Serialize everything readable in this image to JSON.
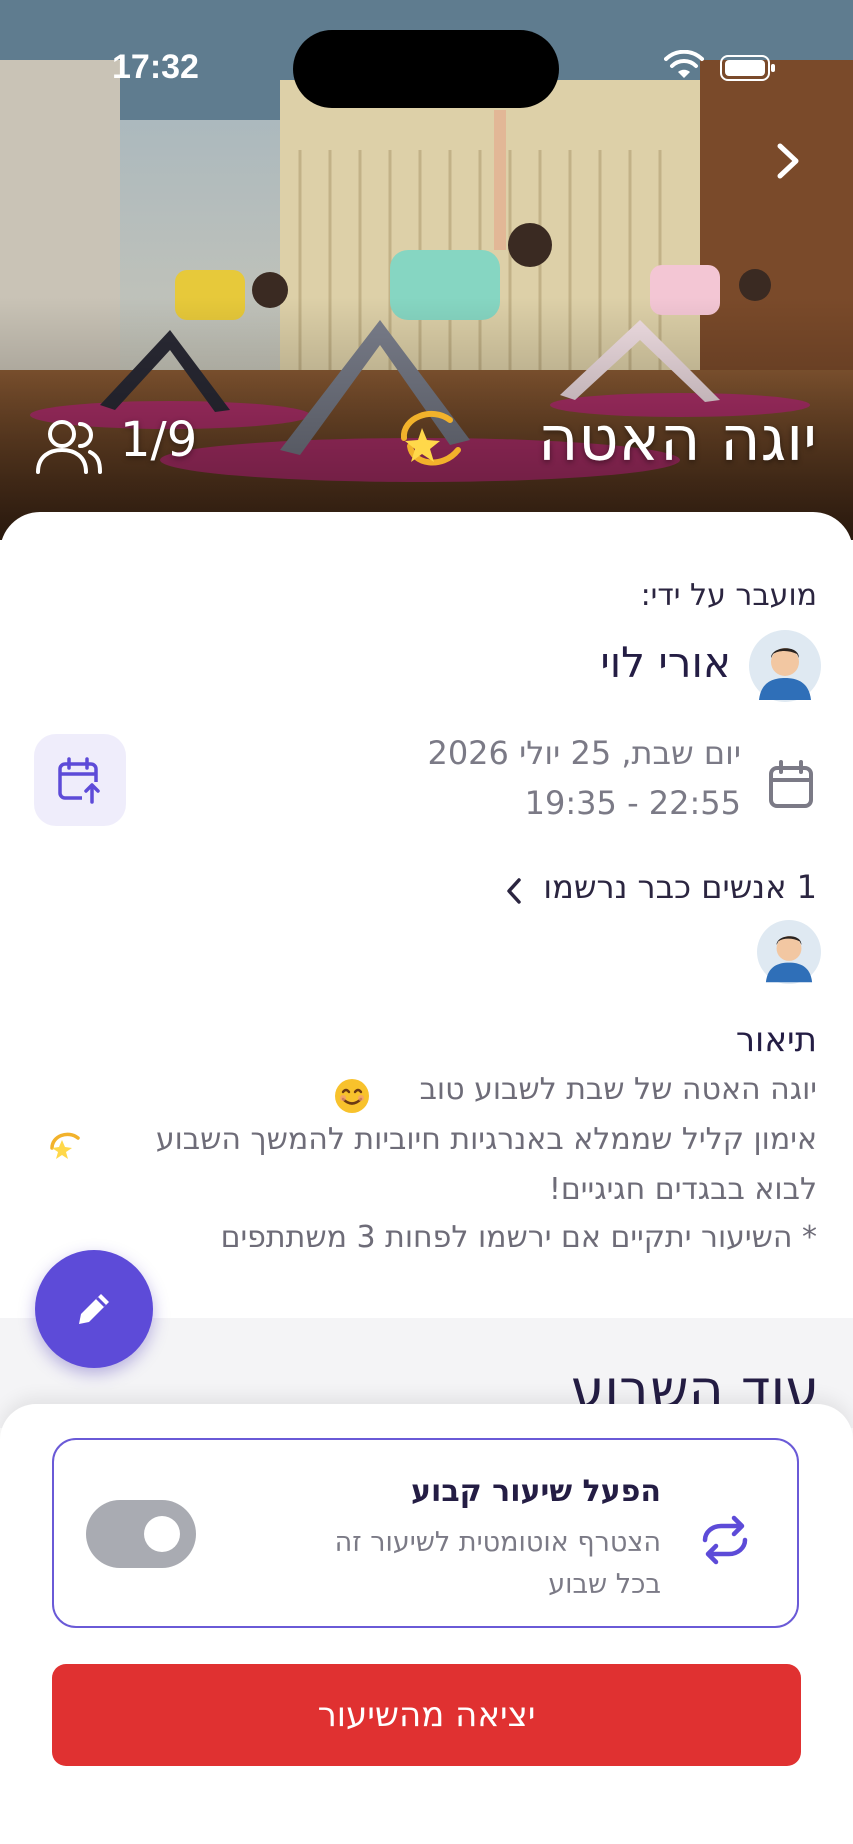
{
  "status_bar": {
    "time": "17:32"
  },
  "hero": {
    "class_title": "יוגה האטה",
    "participants": "1/9"
  },
  "details": {
    "taught_by_label": "מועבר על ידי:",
    "instructor_name": "אורי לוי",
    "date": "יום שבת, 25 יולי 2026",
    "time_range": "19:35 - 22:55",
    "registered_count": "1",
    "registered_label": "אנשים כבר נרשמו"
  },
  "description": {
    "heading": "תיאור",
    "lines": [
      "יוגה האטה של שבת לשבוע טוב",
      "אימון קליל שממלא באנרגיות חיוביות להמשך השבוע",
      "לבוא בבגדים חגיגיים!",
      "* השיעור יתקיים אם ירשמו לפחות 3 משתתפים"
    ]
  },
  "more_section": {
    "heading": "עוד השבוע"
  },
  "recurring": {
    "title": "הפעל שיעור קבוע",
    "description": "הצטרף אוטומטית לשיעור זה בכל שבוע",
    "enabled": false
  },
  "actions": {
    "leave_label": "יציאה מהשיעור"
  },
  "colors": {
    "accent": "#5d4bd8",
    "danger": "#e03131",
    "toggle_off": "#a9abb2"
  }
}
